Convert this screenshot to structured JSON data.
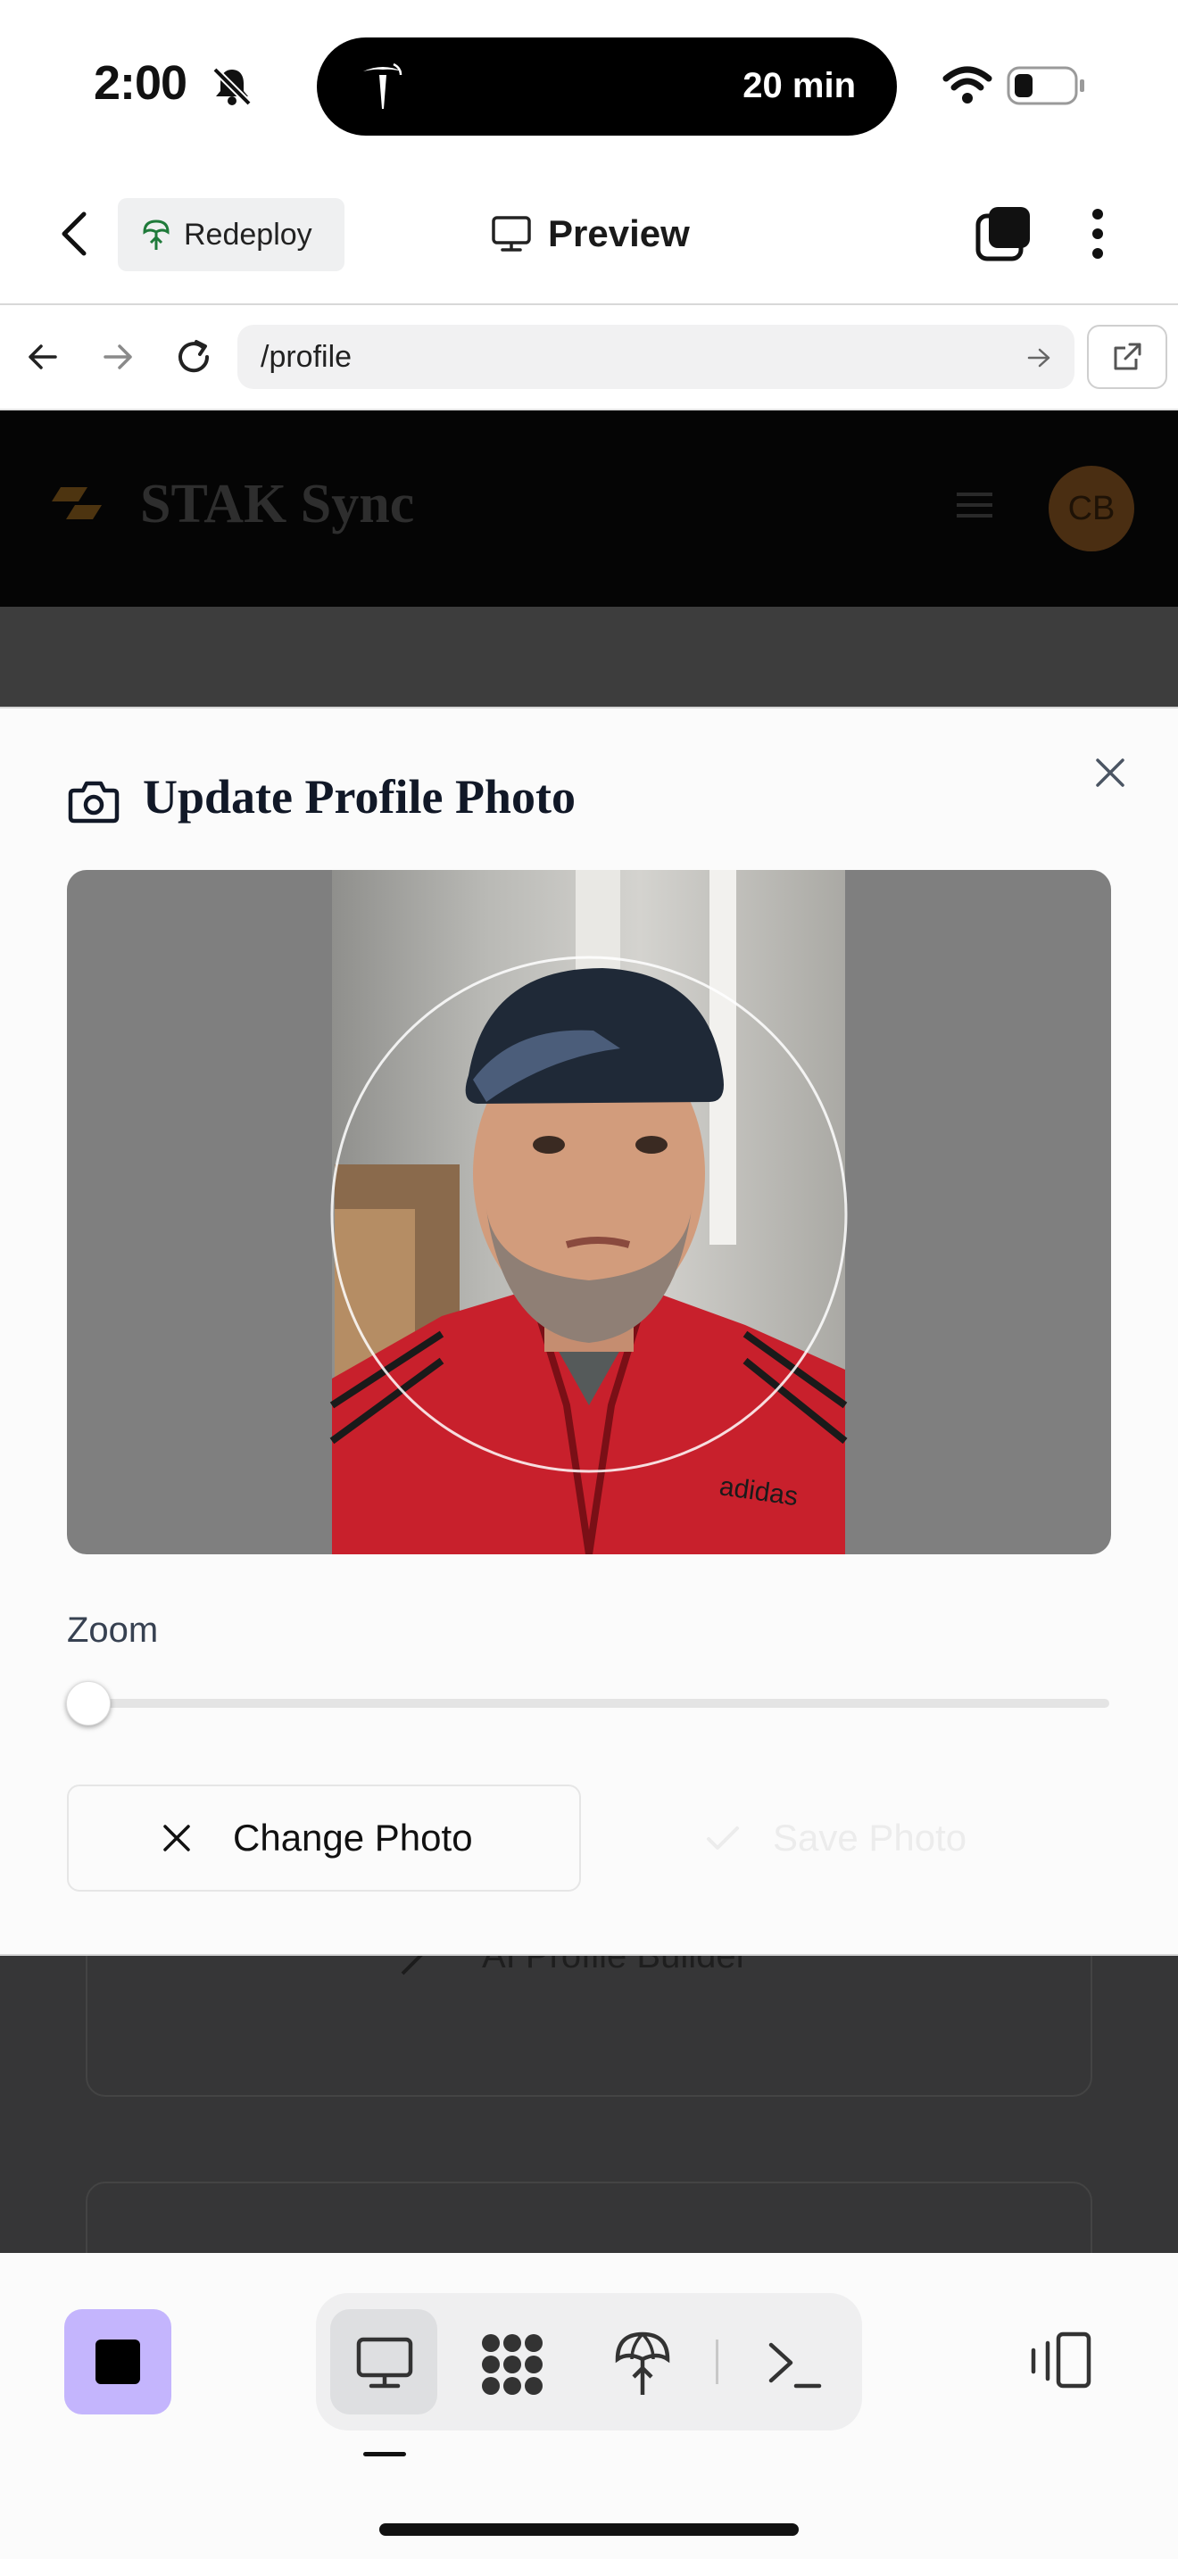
{
  "status_bar": {
    "time": "2:00",
    "island_text": "20 min"
  },
  "header": {
    "redeploy_label": "Redeploy",
    "preview_label": "Preview"
  },
  "url_bar": {
    "path": "/profile"
  },
  "app": {
    "title": "STAK Sync",
    "avatar_initials": "CB",
    "behind_text": "AI Profile Builder"
  },
  "modal": {
    "title": "Update Profile Photo",
    "zoom_label": "Zoom",
    "zoom_value": 0,
    "change_photo_label": "Change Photo",
    "save_photo_label": "Save Photo",
    "photo_brand_text": "adidas"
  },
  "colors": {
    "stop_button": "#c4b5fd",
    "photo_jacket": "#c8202c",
    "modal_bg": "#fbfbfb"
  },
  "icons": [
    "back-chevron-icon",
    "redeploy-icon",
    "monitor-icon",
    "tabs-icon",
    "more-icon",
    "arrow-left-icon",
    "arrow-right-icon",
    "reload-icon",
    "go-arrow-icon",
    "external-link-icon",
    "camera-icon",
    "close-icon",
    "x-icon",
    "check-icon",
    "stop-icon",
    "desktop-icon",
    "apps-icon",
    "deploy-icon",
    "terminal-icon",
    "device-switch-icon"
  ]
}
